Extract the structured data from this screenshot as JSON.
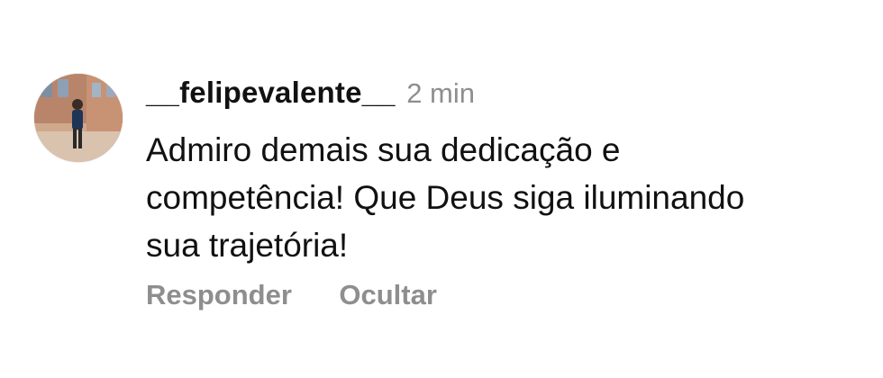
{
  "comment": {
    "username": "__felipevalente__",
    "timestamp": "2 min",
    "text_lines": [
      "Admiro demais sua dedicação e",
      "competência! Que Deus siga iluminando",
      "sua trajetória!"
    ],
    "avatar": {
      "icon": "user-profile-photo"
    }
  },
  "actions": {
    "reply_label": "Responder",
    "hide_label": "Ocultar"
  },
  "colors": {
    "primary_text": "#111111",
    "secondary_text": "#8e8e8e",
    "background": "#ffffff"
  }
}
